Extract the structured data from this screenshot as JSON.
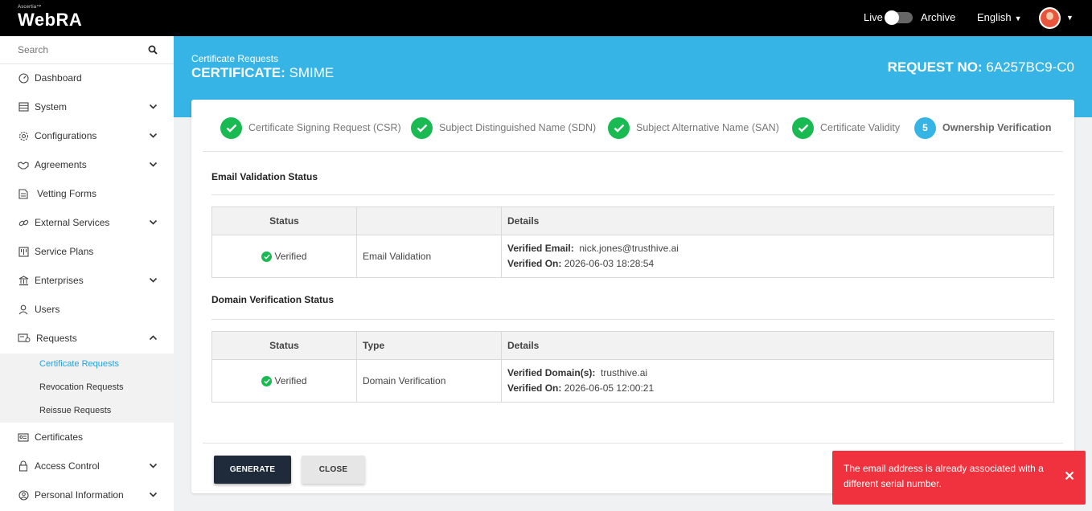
{
  "app": {
    "brand_small": "Ascertia™",
    "name": "WebRA"
  },
  "topbar": {
    "live_label": "Live",
    "archive_label": "Archive",
    "language": "English"
  },
  "sidebar": {
    "search_placeholder": "Search",
    "items": [
      {
        "label": "Dashboard",
        "icon": "dashboard-icon",
        "has_chevron": false
      },
      {
        "label": "System",
        "icon": "system-icon",
        "has_chevron": true
      },
      {
        "label": "Configurations",
        "icon": "gear-icon",
        "has_chevron": true
      },
      {
        "label": "Agreements",
        "icon": "handshake-icon",
        "has_chevron": true
      },
      {
        "label": "Vetting Forms",
        "icon": "form-icon",
        "has_chevron": false
      },
      {
        "label": "External Services",
        "icon": "link-icon",
        "has_chevron": true
      },
      {
        "label": "Service Plans",
        "icon": "plans-icon",
        "has_chevron": false
      },
      {
        "label": "Enterprises",
        "icon": "bank-icon",
        "has_chevron": true
      },
      {
        "label": "Users",
        "icon": "user-icon",
        "has_chevron": false
      },
      {
        "label": "Requests",
        "icon": "requests-icon",
        "has_chevron": true,
        "expanded": true
      },
      {
        "label": "Certificates",
        "icon": "certificate-icon",
        "has_chevron": false
      },
      {
        "label": "Access Control",
        "icon": "lock-icon",
        "has_chevron": true
      },
      {
        "label": "Personal Information",
        "icon": "person-icon",
        "has_chevron": true
      }
    ],
    "sub_items": [
      {
        "label": "Certificate Requests",
        "active": true
      },
      {
        "label": "Revocation Requests",
        "active": false
      },
      {
        "label": "Reissue Requests",
        "active": false
      }
    ]
  },
  "header": {
    "breadcrumb": "Certificate Requests",
    "cert_prefix": "CERTIFICATE:",
    "cert_type": "SMIME",
    "req_prefix": "REQUEST NO:",
    "req_no": "6A257BC9-C0"
  },
  "steps": [
    {
      "label": "Certificate Signing Request (CSR)",
      "done": true
    },
    {
      "label": "Subject Distinguished Name (SDN)",
      "done": true
    },
    {
      "label": "Subject Alternative Name (SAN)",
      "done": true
    },
    {
      "label": "Certificate Validity",
      "done": true
    },
    {
      "label": "Ownership Verification",
      "done": false,
      "number": "5"
    }
  ],
  "email_section": {
    "title": "Email Validation Status",
    "headers": [
      "Status",
      "",
      "Details"
    ],
    "row": {
      "status": "Verified",
      "type": "Email Validation",
      "detail1_label": "Verified Email:",
      "detail1_value": "nick.jones@trusthive.ai",
      "detail2_label": "Verified On:",
      "detail2_value": "2026-06-03 18:28:54"
    }
  },
  "domain_section": {
    "title": "Domain Verification Status",
    "headers": [
      "Status",
      "Type",
      "Details"
    ],
    "row": {
      "status": "Verified",
      "type": "Domain Verification",
      "detail1_label": "Verified Domain(s):",
      "detail1_value": "trusthive.ai",
      "detail2_label": "Verified On:",
      "detail2_value": "2026-06-05 12:00:21"
    }
  },
  "buttons": {
    "generate": "GENERATE",
    "close": "CLOSE"
  },
  "toast": {
    "message": "The email address is already associated with a different serial number.",
    "color": "#f0323e"
  },
  "colors": {
    "accent": "#36b4e5",
    "success": "#1aba52",
    "dark_button": "#1f2b3b"
  }
}
